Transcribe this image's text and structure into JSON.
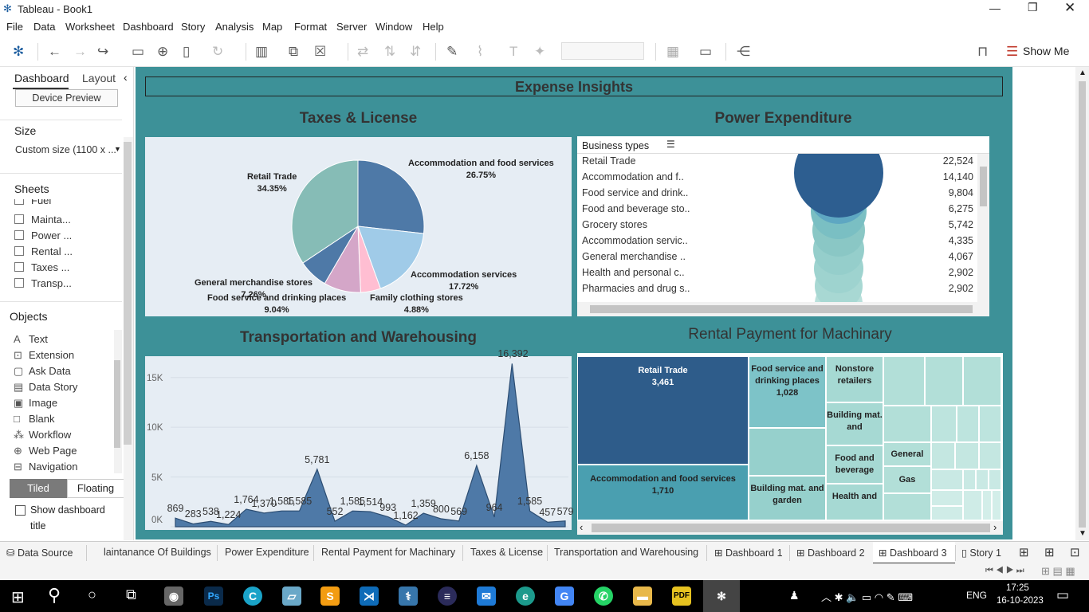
{
  "window": {
    "title": "Tableau - Book1"
  },
  "menu": [
    "File",
    "Data",
    "Worksheet",
    "Dashboard",
    "Story",
    "Analysis",
    "Map",
    "Format",
    "Server",
    "Window",
    "Help"
  ],
  "toolbar": {
    "show_me": "Show Me"
  },
  "left_pane": {
    "tab_dashboard": "Dashboard",
    "tab_layout": "Layout",
    "device_preview": "Device Preview",
    "size_title": "Size",
    "size_value": "Custom size (1100 x ...",
    "sheets_title": "Sheets",
    "sheets": [
      "Fuel",
      "Mainta...",
      "Power ...",
      "Rental ...",
      "Taxes ...",
      "Transp..."
    ],
    "objects_title": "Objects",
    "objects": [
      "Text",
      "Extension",
      "Ask Data",
      "Data Story",
      "Image",
      "Blank",
      "Workflow",
      "Web Page",
      "Navigation"
    ],
    "tiled": "Tiled",
    "floating": "Floating",
    "show_title_line1": "Show dashboard",
    "show_title_line2": "title"
  },
  "dashboard": {
    "title": "Expense Insights",
    "taxes_title": "Taxes & License",
    "power_title": "Power Expenditure",
    "transport_title": "Transportation and Warehousing",
    "rental_title": "Rental Payment for Machinary"
  },
  "pie": {
    "slices": [
      {
        "name": "Accommodation and food services",
        "pct": "26.75%",
        "value": 26.75,
        "color": "#4e79a7"
      },
      {
        "name": "Accommodation services",
        "pct": "17.72%",
        "value": 17.72,
        "color": "#a0cbe8"
      },
      {
        "name": "Family clothing stores",
        "pct": "4.88%",
        "value": 4.88,
        "color": "#ffbed2"
      },
      {
        "name": "Food service and drinking places",
        "pct": "9.04%",
        "value": 9.04,
        "color": "#d4a6c8"
      },
      {
        "name": "General merchandise stores",
        "pct": "7.26%",
        "value": 7.26,
        "color": "#4e79a7"
      },
      {
        "name": "Retail Trade",
        "pct": "34.35%",
        "value": 34.35,
        "color": "#86bcb6"
      }
    ]
  },
  "power": {
    "header": "Business types",
    "rows": [
      {
        "name": "Retail Trade",
        "value": "22,524"
      },
      {
        "name": "Accommodation and f..",
        "value": "14,140"
      },
      {
        "name": "Food service and drink..",
        "value": "9,804"
      },
      {
        "name": "Food and beverage sto..",
        "value": "6,275"
      },
      {
        "name": "Grocery stores",
        "value": "5,742"
      },
      {
        "name": "Accommodation servic..",
        "value": "4,335"
      },
      {
        "name": "General merchandise ..",
        "value": "4,067"
      },
      {
        "name": "Health and personal c..",
        "value": "2,902"
      },
      {
        "name": "Pharmacies and drug s..",
        "value": "2,902"
      }
    ]
  },
  "transport": {
    "y_ticks": [
      "0K",
      "5K",
      "10K",
      "15K"
    ],
    "values": [
      869,
      283,
      538,
      224,
      1764,
      1370,
      1585,
      1585,
      5781,
      552,
      1585,
      1514,
      993,
      162,
      1359,
      800,
      569,
      6158,
      964,
      16392,
      1585,
      457,
      579
    ],
    "labels": [
      "869",
      "283",
      "538",
      "1,224",
      "1,764",
      "1,370",
      "1,585",
      "1,585",
      "5,781",
      "552",
      "1,585",
      "1,514",
      "993",
      "1,162",
      "1,359",
      "800",
      "569",
      "6,158",
      "964",
      "16,392",
      "1,585",
      "457",
      "579"
    ]
  },
  "treemap": {
    "cells": [
      {
        "name": "Retail Trade",
        "value": "3,461",
        "color": "#2e5c8a"
      },
      {
        "name": "Accommodation and food services",
        "value": "1,710",
        "color": "#4a9fb0"
      },
      {
        "name": "Food service and drinking places",
        "value": "1,028",
        "color": "#7dc3c8"
      },
      {
        "name": "Nonstore retailers",
        "value": "",
        "color": "#a6d9d3"
      },
      {
        "name": "Building mat. and",
        "value": "",
        "color": "#a6d9d3"
      },
      {
        "name": "Food and beverage",
        "value": "",
        "color": "#a6d9d3"
      },
      {
        "name": "Health and",
        "value": "",
        "color": "#a6d9d3"
      },
      {
        "name": "Building mat. and garden",
        "value": "",
        "color": "#96d0cc"
      },
      {
        "name": "General",
        "value": "",
        "color": "#b2dfd8"
      },
      {
        "name": "Gas",
        "value": "",
        "color": "#b2dfd8"
      }
    ]
  },
  "tabs": [
    "Data Source",
    "laintanance Of Buildings",
    "Power Expenditure",
    "Rental Payment for Machinary",
    "Taxes & License",
    "Transportation and Warehousing",
    "Dashboard 1",
    "Dashboard 2",
    "Dashboard 3",
    "Story 1"
  ],
  "taskbar": {
    "lang": "ENG",
    "time": "17:25",
    "date": "16-10-2023"
  }
}
